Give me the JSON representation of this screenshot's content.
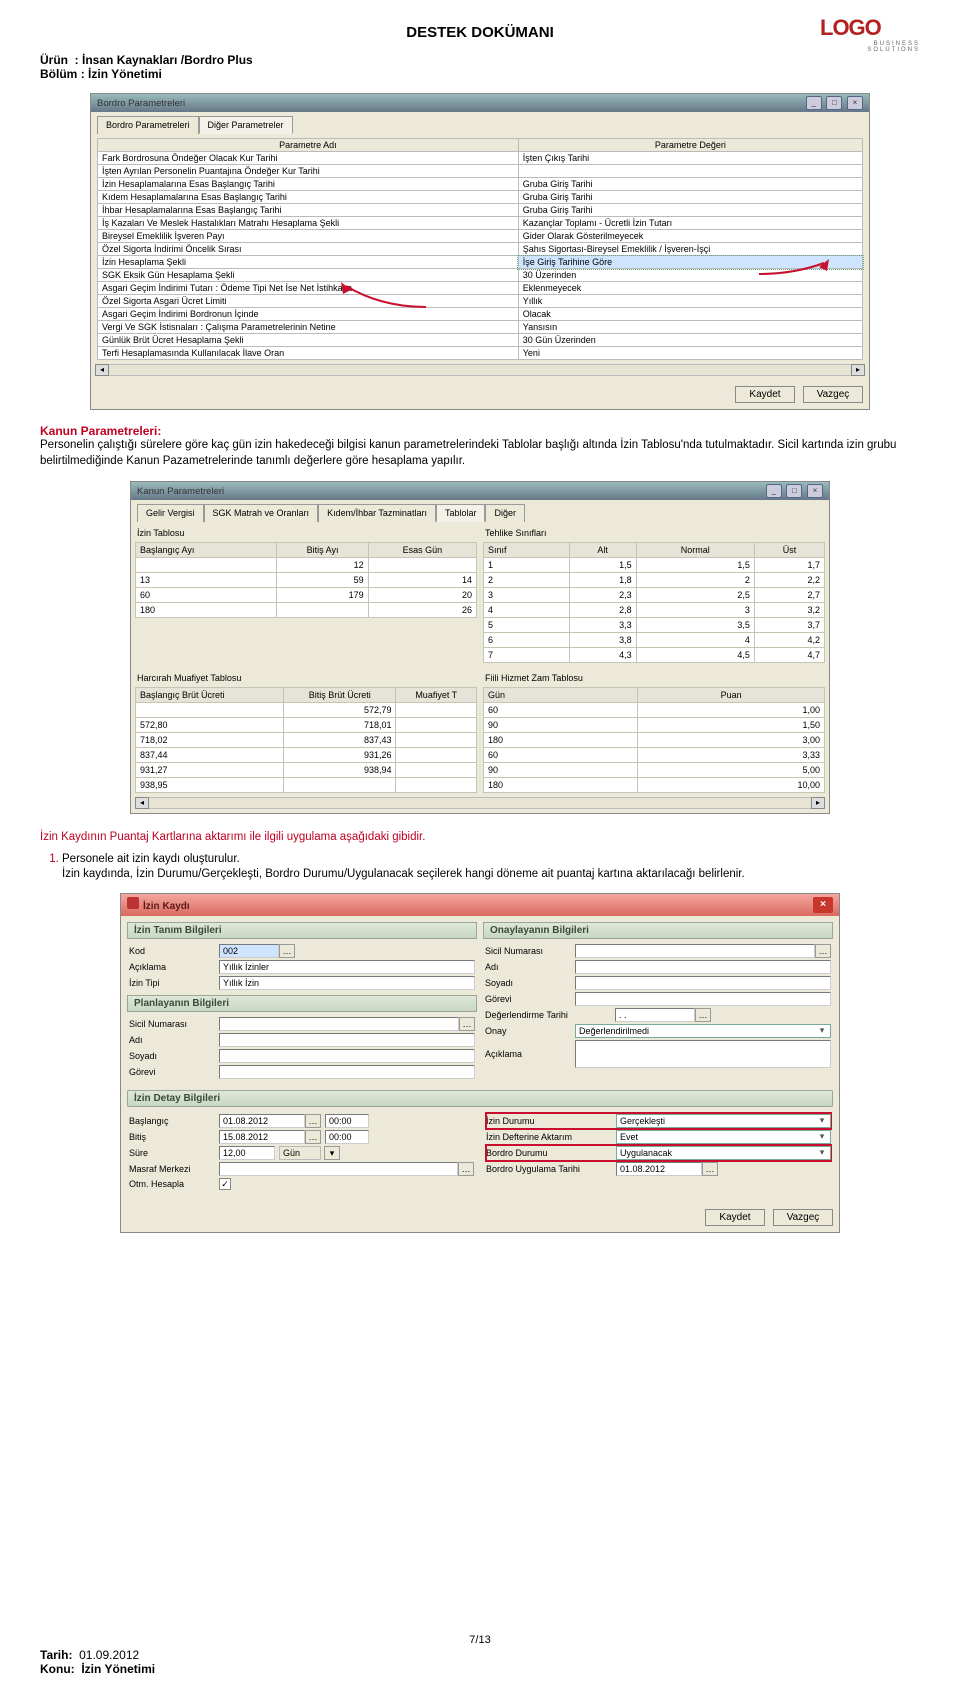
{
  "header": {
    "brand": "LOGO",
    "brand_sub": "BUSINESS SOLUTIONS",
    "title": "DESTEK DOKÜMANI",
    "product_label": "Ürün",
    "product_value": "İnsan Kaynakları /Bordro Plus",
    "section_label": "Bölüm",
    "section_value": "İzin Yönetimi"
  },
  "common": {
    "save": "Kaydet",
    "cancel": "Vazgeç"
  },
  "dialog1": {
    "title": "Bordro Parametreleri",
    "tab1": "Bordro Parametreleri",
    "tab2": "Diğer Parametreler",
    "col1": "Parametre Adı",
    "col2": "Parametre Değeri",
    "rows": [
      [
        "Fark Bordrosuna Öndeğer Olacak Kur Tarihi",
        "İşten Çıkış Tarihi"
      ],
      [
        "İşten Ayrılan Personelin Puantajına Öndeğer Kur Tarihi",
        ""
      ],
      [
        "İzin Hesaplamalarına Esas Başlangıç Tarihi",
        "Gruba Giriş Tarihi"
      ],
      [
        "Kıdem Hesaplamalarına Esas Başlangıç Tarihi",
        "Gruba Giriş Tarihi"
      ],
      [
        "İhbar Hesaplamalarına Esas Başlangıç Tarihi",
        "Gruba Giriş Tarihi"
      ],
      [
        "İş Kazaları Ve Meslek Hastalıkları Matrahı Hesaplama Şekli",
        "Kazançlar Toplamı - Ücretli İzin Tutarı"
      ],
      [
        "Bireysel Emeklilik İşveren Payı",
        "Gider Olarak Gösterilmeyecek"
      ],
      [
        "Özel Sigorta İndirimi Öncelik Sırası",
        "Şahıs Sigortası-Bireysel Emeklilik / İşveren-İşçi"
      ],
      [
        "İzin Hesaplama Şekli",
        "İşe Giriş Tarihine Göre",
        "highlight"
      ],
      [
        "SGK Eksik Gün Hesaplama Şekli",
        "30 Üzerinden"
      ],
      [
        "Asgari Geçim İndirimi Tutarı : Ödeme Tipi Net İse Net İstihkaka",
        "Eklenmeyecek"
      ],
      [
        "Özel Sigorta Asgari Ücret Limiti",
        "Yıllık"
      ],
      [
        "Asgari Geçim İndirimi Bordronun İçinde",
        "Olacak"
      ],
      [
        "Vergi Ve SGK İstisnaları : Çalışma Parametrelerinin Netine",
        "Yansısın"
      ],
      [
        "Günlük Brüt Ücret Hesaplama Şekli",
        "30 Gün Üzerinden"
      ],
      [
        "Terfi Hesaplamasında Kullanılacak İlave Oran",
        "Yeni"
      ]
    ]
  },
  "para1": {
    "heading": "Kanun Parametreleri:",
    "text": "Personelin çalıştığı sürelere göre kaç gün izin hakedeceği bilgisi kanun parametrelerindeki Tablolar başlığı altında İzin Tablosu'nda tutulmaktadır. Sicil kartında izin grubu belirtilmediğinde Kanun Pazametrelerinde tanımlı değerlere göre hesaplama yapılır."
  },
  "dialog2": {
    "title": "Kanun Parametreleri",
    "tabs": [
      "Gelir Vergisi",
      "SGK Matrah ve Oranları",
      "Kıdem/İhbar Tazminatları",
      "Tablolar",
      "Diğer"
    ],
    "izin_label": "İzin Tablosu",
    "izin_cols": [
      "Başlangıç Ayı",
      "Bitiş Ayı",
      "Esas Gün"
    ],
    "izin_rows": [
      [
        "",
        "12",
        ""
      ],
      [
        "13",
        "59",
        "14"
      ],
      [
        "60",
        "179",
        "20"
      ],
      [
        "180",
        "",
        "26"
      ]
    ],
    "tehlike_label": "Tehlike Sınıfları",
    "tehlike_cols": [
      "Sınıf",
      "Alt",
      "Normal",
      "Üst"
    ],
    "tehlike_rows": [
      [
        "1",
        "1,5",
        "1,5",
        "1,7"
      ],
      [
        "2",
        "1,8",
        "2",
        "2,2"
      ],
      [
        "3",
        "2,3",
        "2,5",
        "2,7"
      ],
      [
        "4",
        "2,8",
        "3",
        "3,2"
      ],
      [
        "5",
        "3,3",
        "3,5",
        "3,7"
      ],
      [
        "6",
        "3,8",
        "4",
        "4,2"
      ],
      [
        "7",
        "4,3",
        "4,5",
        "4,7"
      ]
    ],
    "harcirah_label": "Harcırah Muafiyet Tablosu",
    "harcirah_cols": [
      "Başlangıç Brüt Ücreti",
      "Bitiş Brüt Ücreti",
      "Muafiyet T"
    ],
    "harcirah_rows": [
      [
        "",
        "572,79",
        ""
      ],
      [
        "572,80",
        "718,01",
        ""
      ],
      [
        "718,02",
        "837,43",
        ""
      ],
      [
        "837,44",
        "931,26",
        ""
      ],
      [
        "931,27",
        "938,94",
        ""
      ],
      [
        "938,95",
        "",
        ""
      ]
    ],
    "fiili_label": "Fiili Hizmet Zam Tablosu",
    "fiili_cols": [
      "Gün",
      "Puan"
    ],
    "fiili_rows": [
      [
        "60",
        "1,00"
      ],
      [
        "90",
        "1,50"
      ],
      [
        "180",
        "3,00"
      ],
      [
        "60",
        "3,33"
      ],
      [
        "90",
        "5,00"
      ],
      [
        "180",
        "10,00"
      ]
    ]
  },
  "para2": {
    "intro": "İzin Kaydının Puantaj Kartlarına aktarımı ile ilgili uygulama aşağıdaki gibidir.",
    "step1": "Personele ait izin kaydı oluşturulur.",
    "step1b": "İzin kaydında, İzin Durumu/Gerçekleşti, Bordro Durumu/Uygulanacak seçilerek  hangi döneme ait puantaj kartına aktarılacağı  belirlenir."
  },
  "dialog3": {
    "title": "İzin Kaydı",
    "g_tanim": "İzin Tanım Bilgileri",
    "g_planlayan": "Planlayanın Bilgileri",
    "g_onaylayan": "Onaylayanın Bilgileri",
    "g_detay": "İzin Detay Bilgileri",
    "f_kod": "Kod",
    "v_kod": "002",
    "f_aciklama": "Açıklama",
    "v_aciklama": "Yıllık İzinler",
    "f_izintipi": "İzin Tipi",
    "v_izintipi": "Yıllık İzin",
    "f_sicil": "Sicil Numarası",
    "f_adi": "Adı",
    "f_soyadi": "Soyadı",
    "f_gorevi": "Görevi",
    "f_degerlendirme": "Değerlendirme Tarihi",
    "v_degerlendirme": ". .",
    "f_onay": "Onay",
    "v_onay": "Değerlendirilmedi",
    "f_aciklama2": "Açıklama",
    "f_baslangic": "Başlangıç",
    "v_baslangic": "01.08.2012",
    "v_bas_saat": "00:00",
    "f_bitis": "Bitiş",
    "v_bitis": "15.08.2012",
    "v_bit_saat": "00:00",
    "f_sure": "Süre",
    "v_sure": "12,00",
    "v_sure_birim": "Gün",
    "f_masraf": "Masraf Merkezi",
    "f_otm": "Otm. Hesapla",
    "f_izindurumu": "İzin Durumu",
    "v_izindurumu": "Gerçekleşti",
    "f_defter": "İzin Defterine Aktarım",
    "v_defter": "Evet",
    "f_bordrodurumu": "Bordro Durumu",
    "v_bordrodurumu": "Uygulanacak",
    "f_bordrotarih": "Bordro Uygulama Tarihi",
    "v_bordrotarih": "01.08.2012"
  },
  "footer": {
    "page": "7/13",
    "date_label": "Tarih:",
    "date_value": "01.09.2012",
    "topic_label": "Konu:",
    "topic_value": "İzin Yönetimi"
  }
}
